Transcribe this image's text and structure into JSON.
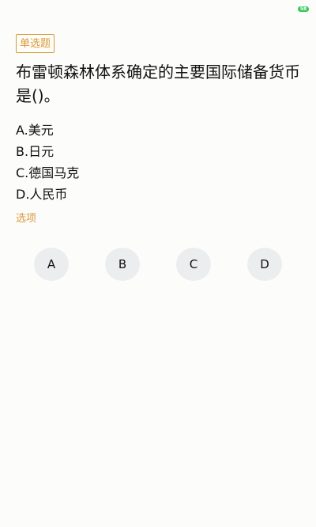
{
  "status_bar": {
    "battery_level": "58",
    "battery_color": "#34c759"
  },
  "question": {
    "type_badge": "单选题",
    "text": "布雷顿森林体系确定的主要国际储备货币是()。",
    "options": [
      "A.美元",
      "B.日元",
      "C.德国马克",
      "D.人民币"
    ]
  },
  "answer": {
    "section_label": "选项",
    "choices": [
      "A",
      "B",
      "C",
      "D"
    ]
  },
  "colors": {
    "accent": "#d79a3d",
    "button_bg": "#ecedef",
    "page_bg": "#fcfcfa"
  }
}
